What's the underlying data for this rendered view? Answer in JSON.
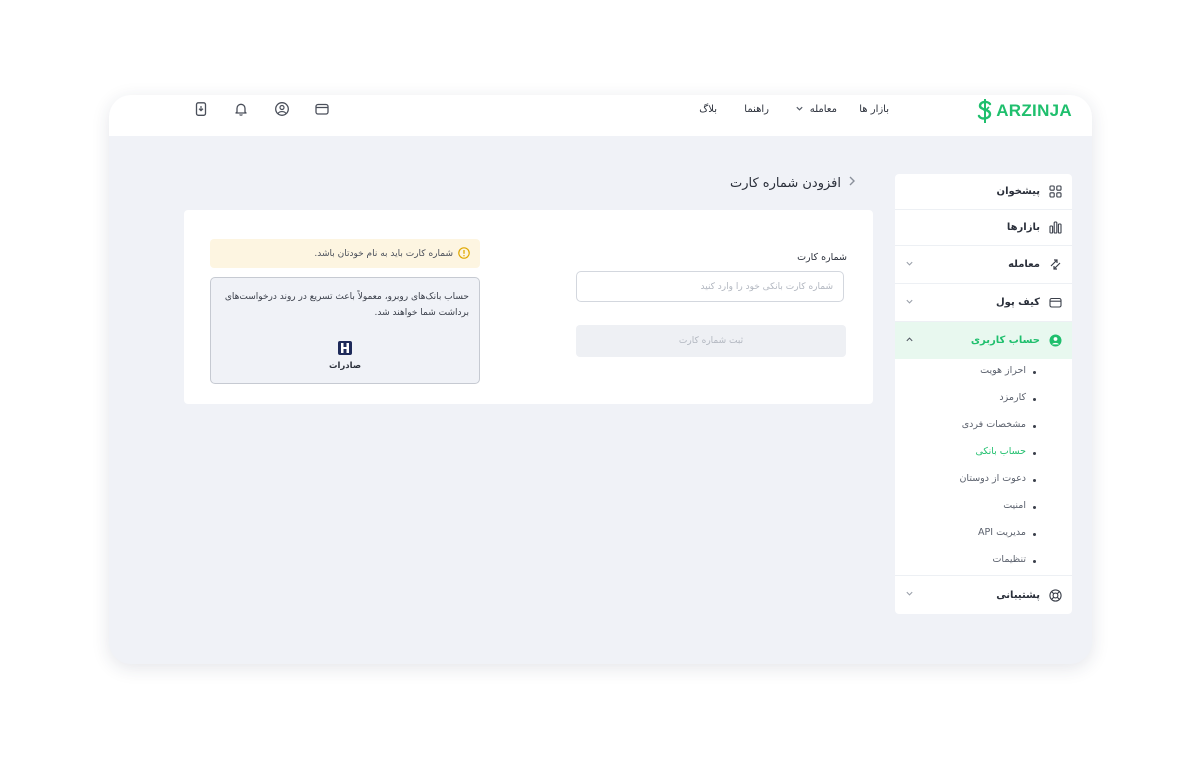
{
  "header": {
    "logo_text": "ARZINJA",
    "nav": [
      {
        "label": "بازار ها"
      },
      {
        "label": "معامله"
      },
      {
        "label": "راهنما"
      },
      {
        "label": "بلاگ"
      }
    ],
    "icons": [
      "wallet-icon",
      "user-circle-icon",
      "bell-icon",
      "phone-download-icon"
    ]
  },
  "sidebar": {
    "items": [
      {
        "label": "پیشخوان",
        "icon": "grid-icon"
      },
      {
        "label": "بازارها",
        "icon": "bar-chart-icon"
      },
      {
        "label": "معامله",
        "icon": "exchange-icon"
      },
      {
        "label": "کیف پول",
        "icon": "wallet-icon"
      },
      {
        "label": "حساب کاربری",
        "icon": "user-circle-icon"
      },
      {
        "label": "پشتیبانی",
        "icon": "lifebuoy-icon"
      }
    ],
    "subitems": [
      {
        "label": "احراز هویت"
      },
      {
        "label": "کارمزد"
      },
      {
        "label": "مشخصات فردی"
      },
      {
        "label": "حساب بانکی",
        "active": true
      },
      {
        "label": "دعوت از دوستان"
      },
      {
        "label": "امنیت"
      },
      {
        "label": "مدیریت API"
      },
      {
        "label": "تنظیمات"
      }
    ]
  },
  "page": {
    "title": "افزودن شماره کارت",
    "field_label": "شماره کارت",
    "input_placeholder": "شماره کارت بانکی خود را وارد کنید",
    "input_value": "",
    "submit_label": "ثبت شماره کارت",
    "warning": "شماره کارت باید به نام خودتان باشد.",
    "info_text": "حساب بانک‌های روبرو، معمولاً باعث تسریع در روند درخواست‌های برداشت شما خواهند شد.",
    "bank_name": "صادرات"
  },
  "colors": {
    "brand": "#1fbf6d",
    "active_bg": "#e8f8ef",
    "warning_bg": "#fdf5e1",
    "warning_icon": "#e0a800",
    "page_bg": "#f0f2f7"
  }
}
